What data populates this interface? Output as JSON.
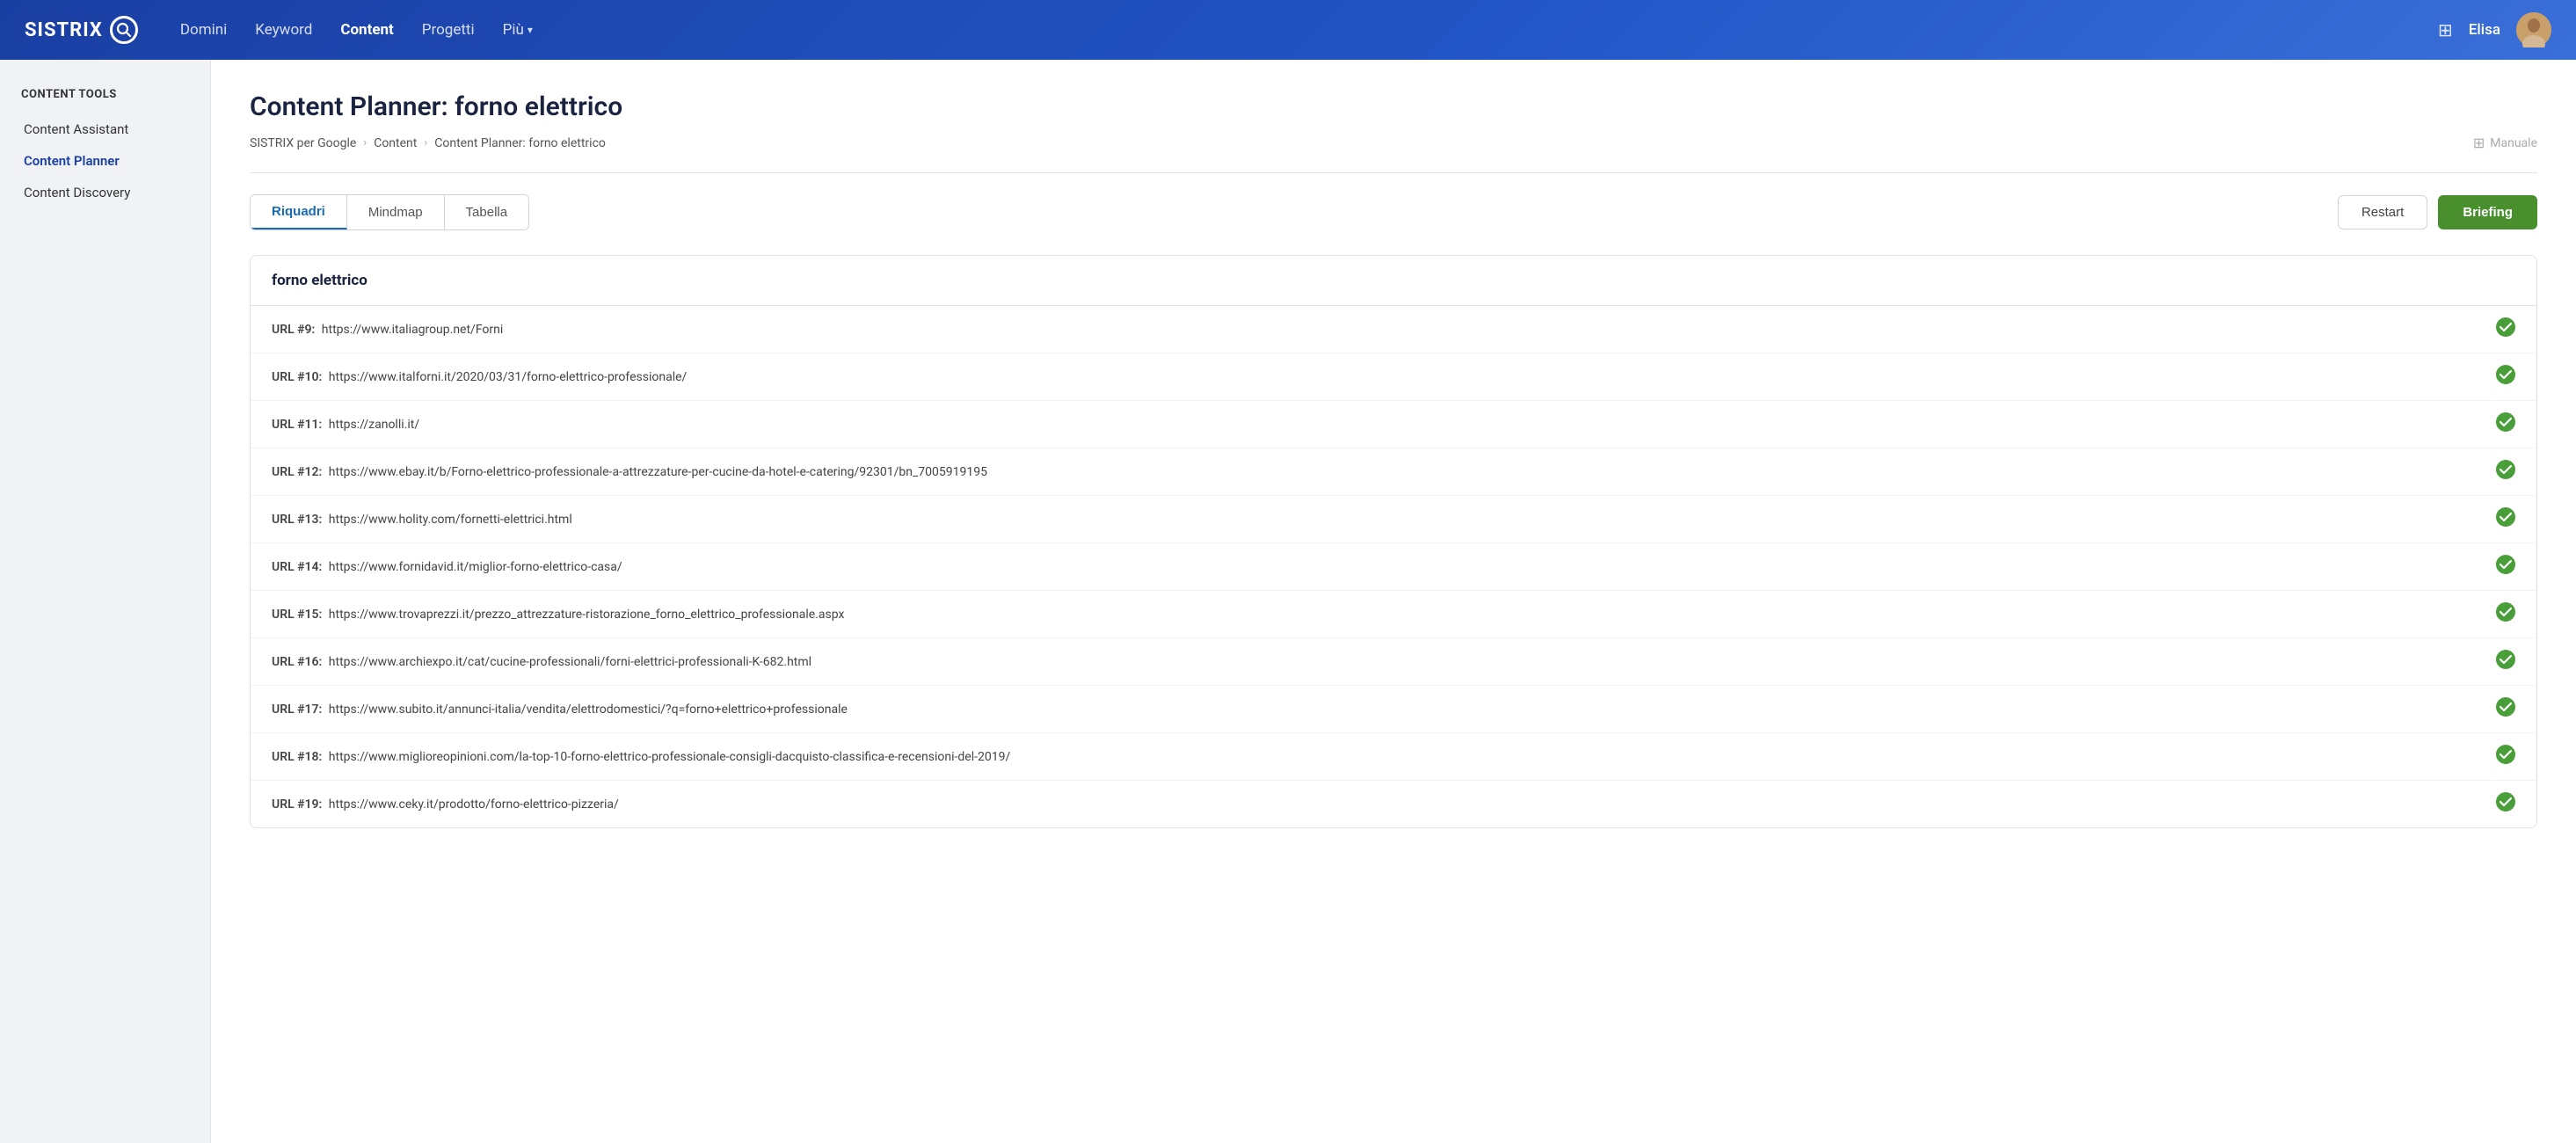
{
  "topnav": {
    "logo_text": "SISTRIX",
    "nav_items": [
      {
        "label": "Domini",
        "active": false
      },
      {
        "label": "Keyword",
        "active": false
      },
      {
        "label": "Content",
        "active": true
      },
      {
        "label": "Progetti",
        "active": false
      },
      {
        "label": "Più",
        "active": false,
        "has_chevron": true
      }
    ],
    "user_name": "Elisa"
  },
  "sidebar": {
    "section_title": "CONTENT TOOLS",
    "items": [
      {
        "label": "Content Assistant",
        "active": false
      },
      {
        "label": "Content Planner",
        "active": true
      },
      {
        "label": "Content Discovery",
        "active": false
      }
    ]
  },
  "page": {
    "title": "Content Planner: forno elettrico",
    "breadcrumb": [
      {
        "label": "SISTRIX per Google"
      },
      {
        "label": "Content"
      },
      {
        "label": "Content Planner: forno elettrico"
      }
    ],
    "manual_label": "Manuale"
  },
  "tabs": {
    "items": [
      {
        "label": "Riquadri",
        "active": true
      },
      {
        "label": "Mindmap",
        "active": false
      },
      {
        "label": "Tabella",
        "active": false
      }
    ],
    "restart_label": "Restart",
    "briefing_label": "Briefing"
  },
  "content_card": {
    "title": "forno elettrico",
    "urls": [
      {
        "id": "#9",
        "url": "https://www.italiagroup.net/Forni",
        "checked": true
      },
      {
        "id": "#10",
        "url": "https://www.italforni.it/2020/03/31/forno-elettrico-professionale/",
        "checked": true
      },
      {
        "id": "#11",
        "url": "https://zanolli.it/",
        "checked": true
      },
      {
        "id": "#12",
        "url": "https://www.ebay.it/b/Forno-elettrico-professionale-a-attrezzature-per-cucine-da-hotel-e-catering/92301/bn_7005919195",
        "checked": true
      },
      {
        "id": "#13",
        "url": "https://www.holity.com/fornetti-elettrici.html",
        "checked": true
      },
      {
        "id": "#14",
        "url": "https://www.fornidavid.it/miglior-forno-elettrico-casa/",
        "checked": true
      },
      {
        "id": "#15",
        "url": "https://www.trovaprezzi.it/prezzo_attrezzature-ristorazione_forno_elettrico_professionale.aspx",
        "checked": true
      },
      {
        "id": "#16",
        "url": "https://www.archiexpo.it/cat/cucine-professionali/forni-elettrici-professionali-K-682.html",
        "checked": true
      },
      {
        "id": "#17",
        "url": "https://www.subito.it/annunci-italia/vendita/elettrodomestici/?q=forno+elettrico+professionale",
        "checked": true
      },
      {
        "id": "#18",
        "url": "https://www.miglioreopinioni.com/la-top-10-forno-elettrico-professionale-consigli-dacquisto-classifica-e-recensioni-del-2019/",
        "checked": true
      },
      {
        "id": "#19",
        "url": "https://www.ceky.it/prodotto/forno-elettrico-pizzeria/",
        "checked": true
      }
    ]
  }
}
